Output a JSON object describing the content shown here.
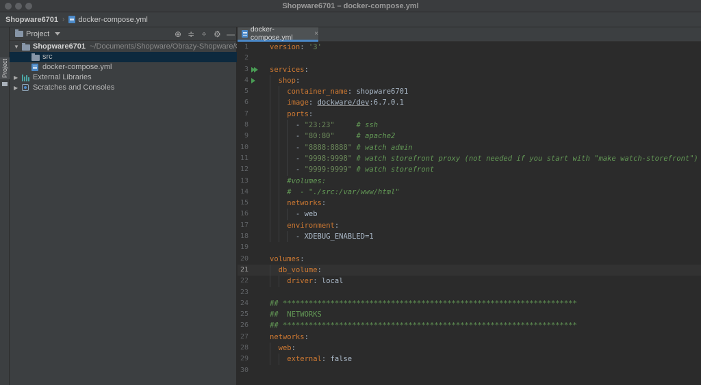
{
  "window": {
    "title": "Shopware6701 – docker-compose.yml"
  },
  "navbar": {
    "project": "Shopware6701",
    "file": "docker-compose.yml"
  },
  "toolstrip": {
    "project_label": "Project"
  },
  "project_panel": {
    "title": "Project",
    "tree": [
      {
        "label": "Shopware6701",
        "path": "~/Documents/Shopware/Obrazy-Shopware/Obrazy",
        "icon": "folder-icon",
        "level": 0,
        "expanded": true,
        "bold": true,
        "selected": false
      },
      {
        "label": "src",
        "icon": "folder-icon",
        "level": 1,
        "selected": true
      },
      {
        "label": "docker-compose.yml",
        "icon": "yaml-file-icon",
        "level": 1,
        "selected": false
      },
      {
        "label": "External Libraries",
        "icon": "libraries-icon",
        "level": 0,
        "collapsed": true
      },
      {
        "label": "Scratches and Consoles",
        "icon": "scratches-icon",
        "level": 0,
        "collapsed": true
      }
    ]
  },
  "editor": {
    "tab": {
      "label": "docker-compose.yml"
    },
    "current_line": 21,
    "lines": [
      {
        "n": "1",
        "parts": [
          [
            "k",
            "version"
          ],
          [
            "p",
            ": "
          ],
          [
            "s",
            "'3'"
          ]
        ]
      },
      {
        "n": "2",
        "parts": []
      },
      {
        "n": "3",
        "run": "double",
        "parts": [
          [
            "k",
            "services"
          ],
          [
            "p",
            ":"
          ]
        ]
      },
      {
        "n": "4",
        "run": "single",
        "parts": [
          [
            "p",
            "  "
          ],
          [
            "k",
            "shop"
          ],
          [
            "p",
            ":"
          ]
        ]
      },
      {
        "n": "5",
        "parts": [
          [
            "p",
            "    "
          ],
          [
            "k",
            "container_name"
          ],
          [
            "p",
            ": shopware6701"
          ]
        ]
      },
      {
        "n": "6",
        "parts": [
          [
            "p",
            "    "
          ],
          [
            "k",
            "image"
          ],
          [
            "p",
            ": "
          ],
          [
            "u",
            "dockware/dev"
          ],
          [
            "p",
            ":6.7.0.1"
          ]
        ]
      },
      {
        "n": "7",
        "parts": [
          [
            "p",
            "    "
          ],
          [
            "k",
            "ports"
          ],
          [
            "p",
            ":"
          ]
        ]
      },
      {
        "n": "8",
        "parts": [
          [
            "p",
            "      - "
          ],
          [
            "s",
            "\"23:23\""
          ],
          [
            "p",
            "     "
          ],
          [
            "c",
            "# ssh"
          ]
        ]
      },
      {
        "n": "9",
        "parts": [
          [
            "p",
            "      - "
          ],
          [
            "s",
            "\"80:80\""
          ],
          [
            "p",
            "     "
          ],
          [
            "c",
            "# apache2"
          ]
        ]
      },
      {
        "n": "10",
        "parts": [
          [
            "p",
            "      - "
          ],
          [
            "s",
            "\"8888:8888\""
          ],
          [
            "p",
            " "
          ],
          [
            "c",
            "# watch admin"
          ]
        ]
      },
      {
        "n": "11",
        "parts": [
          [
            "p",
            "      - "
          ],
          [
            "s",
            "\"9998:9998\""
          ],
          [
            "p",
            " "
          ],
          [
            "c",
            "# watch storefront proxy (not needed if you start with \"make watch-storefront\")"
          ]
        ]
      },
      {
        "n": "12",
        "parts": [
          [
            "p",
            "      - "
          ],
          [
            "s",
            "\"9999:9999\""
          ],
          [
            "p",
            " "
          ],
          [
            "c",
            "# watch storefront"
          ]
        ]
      },
      {
        "n": "13",
        "parts": [
          [
            "p",
            "    "
          ],
          [
            "c",
            "#volumes:"
          ]
        ]
      },
      {
        "n": "14",
        "parts": [
          [
            "p",
            "    "
          ],
          [
            "c",
            "#  - \"./src:/var/www/html\""
          ]
        ]
      },
      {
        "n": "15",
        "parts": [
          [
            "p",
            "    "
          ],
          [
            "k",
            "networks"
          ],
          [
            "p",
            ":"
          ]
        ]
      },
      {
        "n": "16",
        "parts": [
          [
            "p",
            "      - web"
          ]
        ]
      },
      {
        "n": "17",
        "parts": [
          [
            "p",
            "    "
          ],
          [
            "k",
            "environment"
          ],
          [
            "p",
            ":"
          ]
        ]
      },
      {
        "n": "18",
        "parts": [
          [
            "p",
            "      - XDEBUG_ENABLED=1"
          ]
        ]
      },
      {
        "n": "19",
        "parts": []
      },
      {
        "n": "20",
        "parts": [
          [
            "k",
            "volumes"
          ],
          [
            "p",
            ":"
          ]
        ]
      },
      {
        "n": "21",
        "parts": [
          [
            "p",
            "  "
          ],
          [
            "k",
            "db_volume"
          ],
          [
            "p",
            ":"
          ]
        ]
      },
      {
        "n": "22",
        "parts": [
          [
            "p",
            "    "
          ],
          [
            "k",
            "driver"
          ],
          [
            "p",
            ": local"
          ]
        ]
      },
      {
        "n": "23",
        "parts": []
      },
      {
        "n": "24",
        "parts": [
          [
            "h",
            "## ********************************************************************"
          ]
        ]
      },
      {
        "n": "25",
        "parts": [
          [
            "h",
            "##  NETWORKS"
          ]
        ]
      },
      {
        "n": "26",
        "parts": [
          [
            "h",
            "## ********************************************************************"
          ]
        ]
      },
      {
        "n": "27",
        "parts": [
          [
            "k",
            "networks"
          ],
          [
            "p",
            ":"
          ]
        ]
      },
      {
        "n": "28",
        "parts": [
          [
            "p",
            "  "
          ],
          [
            "k",
            "web"
          ],
          [
            "p",
            ":"
          ]
        ]
      },
      {
        "n": "29",
        "parts": [
          [
            "p",
            "    "
          ],
          [
            "k",
            "external"
          ],
          [
            "p",
            ": false"
          ]
        ]
      },
      {
        "n": "30",
        "parts": []
      }
    ]
  },
  "colors": {
    "keyword": "#cc7832",
    "string": "#6a8759",
    "comment": "#629755",
    "selection": "#0d293e",
    "tab_underline": "#4a88c7"
  }
}
